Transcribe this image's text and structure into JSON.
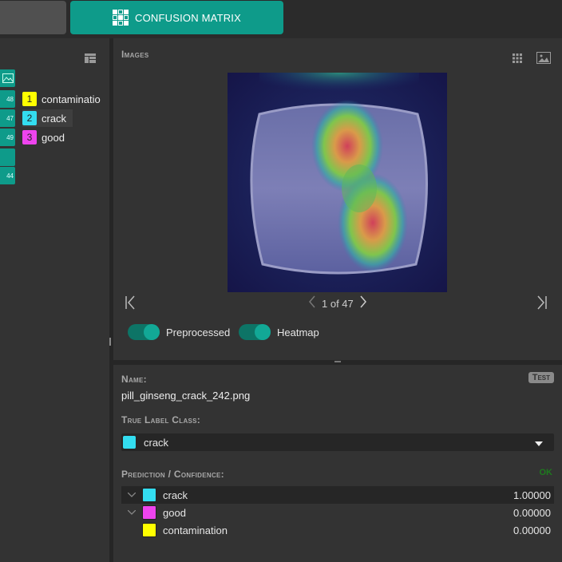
{
  "header": {
    "tab_label": "CONFUSION MATRIX",
    "tab_icon": "grid-icon"
  },
  "left_panel": {
    "tile_numbers": [
      "48",
      "47",
      "49",
      "44"
    ],
    "labels": [
      {
        "index": "1",
        "name": "contaminatio",
        "color": "#ffff00"
      },
      {
        "index": "2",
        "name": "crack",
        "color": "#33ddf0"
      },
      {
        "index": "3",
        "name": "good",
        "color": "#ee44ee"
      }
    ]
  },
  "images_panel": {
    "title": "Images",
    "pager": "1 of 47",
    "toggles": [
      {
        "label": "Preprocessed",
        "on": true
      },
      {
        "label": "Heatmap",
        "on": true
      }
    ]
  },
  "info_panel": {
    "name_title": "Name:",
    "name_value": "pill_ginseng_crack_242.png",
    "badge": "Test",
    "true_label_title": "True Label Class:",
    "true_label_value": "crack",
    "true_label_color": "#33ddf0",
    "prediction_title": "Prediction / Confidence:",
    "prediction_status": "OK",
    "predictions": [
      {
        "label": "crack",
        "value": "1.00000",
        "color": "#33ddf0"
      },
      {
        "label": "good",
        "value": "0.00000",
        "color": "#ee44ee"
      },
      {
        "label": "contamination",
        "value": "0.00000",
        "color": "#ffff00"
      }
    ]
  }
}
